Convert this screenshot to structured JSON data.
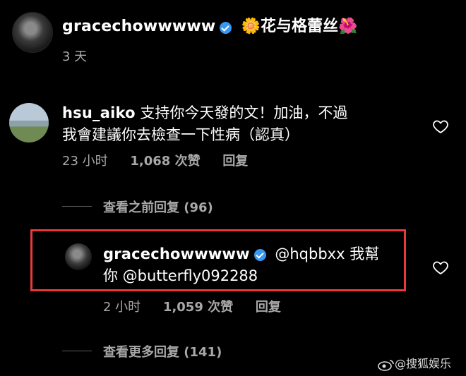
{
  "post": {
    "username": "gracechowwwww",
    "caption_flower1": "🌼",
    "caption_text": "花与格蕾丝",
    "caption_flower2": "🌺",
    "time": "3 天"
  },
  "comment1": {
    "username": "hsu_aiko",
    "text_line1": "支持你今天發的文！加油，不過",
    "text_line2": "我會建議你去檢查一下性病（認真）",
    "time": "23 小时",
    "likes": "1,068 次赞",
    "reply_label": "回复",
    "view_replies": "查看之前回复 (96)"
  },
  "reply1": {
    "username": "gracechowwwww",
    "text_line1": "@hqbbxx 我幫",
    "text_line2": "你 @butterfly092288",
    "time": "2 小时",
    "likes": "1,059 次赞",
    "reply_label": "回复",
    "view_more": "查看更多回复 (141)"
  },
  "watermark": {
    "text": "@搜狐娱乐"
  },
  "colors": {
    "background": "#000000",
    "verified": "#3897f0",
    "highlight_border": "#e83a3a",
    "meta_text": "#a8a8a8"
  }
}
